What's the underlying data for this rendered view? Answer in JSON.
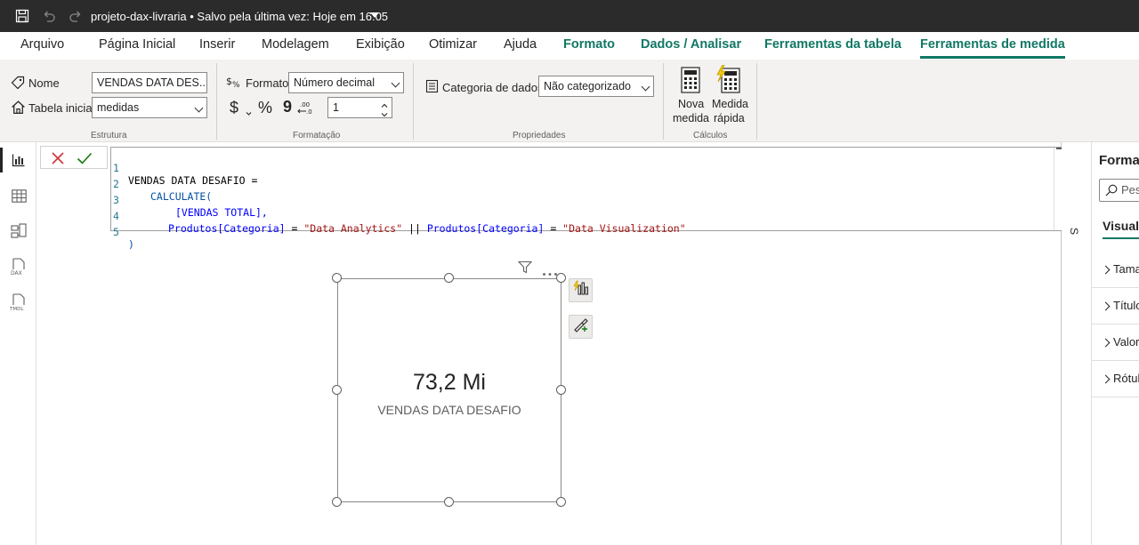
{
  "titlebar": {
    "document_title": "projeto-dax-livraria • Salvo pela última vez: Hoje em 16:05"
  },
  "tabs": [
    {
      "label": "Arquivo"
    },
    {
      "label": "Página Inicial"
    },
    {
      "label": "Inserir"
    },
    {
      "label": "Modelagem"
    },
    {
      "label": "Exibição"
    },
    {
      "label": "Otimizar"
    },
    {
      "label": "Ajuda"
    },
    {
      "label": "Formato"
    },
    {
      "label": "Dados / Analisar"
    },
    {
      "label": "Ferramentas da tabela"
    },
    {
      "label": "Ferramentas de medida"
    }
  ],
  "ribbon": {
    "estrutura": {
      "name_label": "Nome",
      "name_value": "VENDAS DATA DES...",
      "home_table_label": "Tabela inicial",
      "home_table_value": "medidas",
      "group_name": "Estrutura"
    },
    "formatacao": {
      "format_label": "Formato",
      "format_value": "Número decimal",
      "currency_symbol": "$",
      "percent_symbol": "%",
      "comma_symbol": "9",
      "decimals_value": "1",
      "group_name": "Formatação"
    },
    "propriedades": {
      "data_category_label": "Categoria de dados",
      "data_category_value": "Não categorizado",
      "group_name": "Propriedades"
    },
    "calculos": {
      "new_measure_line1": "Nova",
      "new_measure_line2": "medida",
      "quick_measure_line1": "Medida",
      "quick_measure_line2": "rápida",
      "group_name": "Cálculos"
    }
  },
  "formula": {
    "lines": [
      {
        "n": "1",
        "parts": [
          "VENDAS DATA DESAFIO ="
        ]
      },
      {
        "n": "2",
        "parts": [
          "CALCULATE("
        ]
      },
      {
        "n": "3",
        "parts": [
          "[VENDAS TOTAL],"
        ]
      },
      {
        "n": "4",
        "parts": [
          "Produtos",
          "[Categoria]",
          " = ",
          "\"Data Analytics\"",
          " || ",
          "Produtos",
          "[Categoria]",
          " = ",
          "\"Data Visualization\""
        ]
      },
      {
        "n": "5",
        "parts": [
          ")"
        ]
      }
    ]
  },
  "card": {
    "value": "73,2 Mi",
    "label": "VENDAS DATA DESAFIO"
  },
  "right_pane": {
    "title": "Forma",
    "search_placeholder": "Pes",
    "tab_visual": "Visual",
    "sections": [
      "Tamar",
      "Título",
      "Valor",
      "Rótul"
    ],
    "collapsed_label": "S"
  },
  "colors": {
    "accent": "#117865",
    "titlebar": "#2b2b2b",
    "ribbon_bg": "#f3f2f1"
  },
  "icons": {
    "save": "save-icon",
    "undo": "undo-icon",
    "redo": "redo-icon",
    "tag": "tag-icon",
    "home": "home-icon",
    "format": "format-icon",
    "data_category": "data-category-icon",
    "new_measure": "calculator-icon",
    "quick_measure": "quick-measure-icon",
    "cancel": "x-icon",
    "commit": "check-icon",
    "filter": "filter-icon",
    "more": "more-options-icon",
    "report_view": "report-view-icon",
    "table_view": "table-view-icon",
    "model_view": "model-view-icon",
    "dax_view": "dax-query-icon",
    "tmdl_view": "tmdl-icon",
    "search": "search-icon"
  }
}
